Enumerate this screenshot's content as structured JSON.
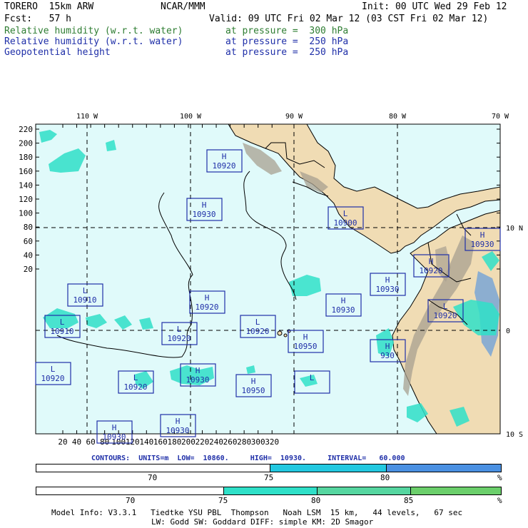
{
  "header": {
    "model": "TORERO  15km ARW",
    "center": "NCAR/MMM",
    "init": "Init: 00 UTC Wed 29 Feb 12",
    "fcst": "Fcst:   57 h",
    "valid": "Valid: 09 UTC Fri 02 Mar 12 (03 CST Fri 02 Mar 12)",
    "fields": [
      {
        "name": "Relative humidity (w.r.t. water)",
        "level": "at pressure =  300 hPa",
        "color": "#2e7d32"
      },
      {
        "name": "Relative humidity (w.r.t. water)",
        "level": "at pressure =  250 hPa",
        "color": "#1f2fa8"
      },
      {
        "name": "Geopotential height",
        "level": "at pressure =  250 hPa",
        "color": "#1f2fa8"
      }
    ]
  },
  "map": {
    "lon_labels": [
      "110 W",
      "100 W",
      "90 W",
      "80 W",
      "70 W"
    ],
    "lat_labels": [
      "10 N",
      "0",
      "10 S"
    ],
    "y_ticks": [
      "220",
      "200",
      "180",
      "160",
      "140",
      "120",
      "100",
      "80",
      "60",
      "40",
      "20"
    ],
    "x_ticks": [
      "20",
      "40",
      "60",
      "80",
      "100",
      "120",
      "140",
      "160",
      "180",
      "200",
      "220",
      "240",
      "260",
      "280",
      "300",
      "320"
    ],
    "centers": [
      {
        "type": "H",
        "value": "10920"
      },
      {
        "type": "H",
        "value": "10930"
      },
      {
        "type": "L",
        "value": "10900"
      },
      {
        "type": "H",
        "value": "10930"
      },
      {
        "type": "H",
        "value": "10920"
      },
      {
        "type": "L",
        "value": "10910"
      },
      {
        "type": "H",
        "value": "10930"
      },
      {
        "type": "H",
        "value": "10920"
      },
      {
        "type": "L",
        "value": "10920"
      },
      {
        "type": "H",
        "value": "10930"
      },
      {
        "type": "L",
        "value": "10910"
      },
      {
        "type": "L",
        "value": "10920"
      },
      {
        "type": "L",
        "value": "10920"
      },
      {
        "type": "H",
        "value": "10950"
      },
      {
        "type": "H",
        "value": "930"
      },
      {
        "type": "L",
        "value": "10920"
      },
      {
        "type": "H",
        "value": "10930"
      },
      {
        "type": "L",
        "value": "10920"
      },
      {
        "type": "H",
        "value": "10950"
      },
      {
        "type": "L",
        "value": ""
      },
      {
        "type": "H",
        "value": "10930"
      },
      {
        "type": "H",
        "value": "10930"
      }
    ]
  },
  "contour_info": "CONTOURS:  UNITS=m  LOW=  10860.     HIGH=  10930.     INTERVAL=   60.000",
  "colorbar_250": {
    "labels": [
      "70",
      "75",
      "80",
      "%"
    ],
    "colors": [
      "#ffffff",
      "#22c8e0",
      "#4a90e2"
    ]
  },
  "colorbar_300": {
    "labels": [
      "70",
      "75",
      "80",
      "85",
      "%"
    ],
    "colors": [
      "#ffffff",
      "#2fe0c8",
      "#55d6a0",
      "#6bcf6b"
    ]
  },
  "footer": {
    "line1": "Model Info: V3.3.1   Tiedtke YSU PBL  Thompson   Noah LSM  15 km,   44 levels,   67 sec",
    "line2": "LW: Godd SW: Goddard DIFF: simple KM: 2D Smagor"
  },
  "colors": {
    "ocean": "#e0fafa",
    "land": "#f0dcb4",
    "mountain": "#a8a090",
    "grid": "#000000"
  }
}
